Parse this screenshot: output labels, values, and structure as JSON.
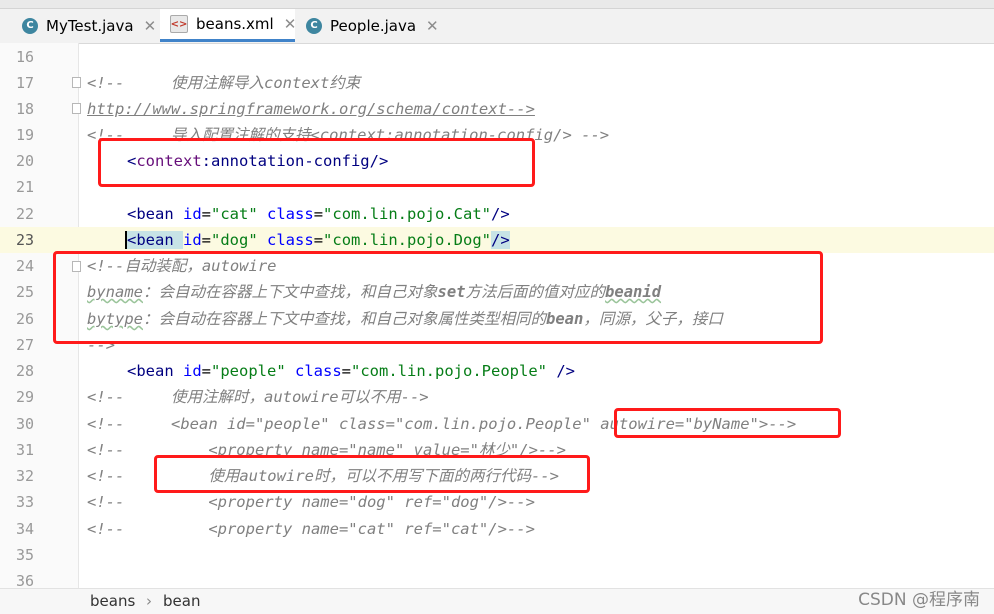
{
  "tabs": [
    {
      "label": "MyTest.java",
      "icon": "java-class-icon",
      "active": false
    },
    {
      "label": "beans.xml",
      "icon": "xml-file-icon",
      "active": true
    },
    {
      "label": "People.java",
      "icon": "java-class-icon",
      "active": false
    }
  ],
  "lines": [
    {
      "num": "16"
    },
    {
      "num": "17",
      "c1": "<!--     使用注解导入context约束"
    },
    {
      "num": "18",
      "c1": "http://www.springframework.org/schema/context-->"
    },
    {
      "num": "19",
      "c1": "<!--     导入配置注解的支持<context:annotation-config/> -->"
    },
    {
      "num": "20",
      "c1": "<",
      "c2": "context",
      "c3": ":annotation-config",
      "c4": "/>"
    },
    {
      "num": "21"
    },
    {
      "num": "22",
      "c1": "<bean ",
      "c2": "id",
      "c3": "=",
      "c4": "\"cat\"",
      "c5": " class",
      "c6": "=",
      "c7": "\"com.lin.pojo.Cat\"",
      "c8": "/>"
    },
    {
      "num": "23",
      "c1": "<bean ",
      "c2": "id",
      "c3": "=",
      "c4": "\"dog\"",
      "c5": " class",
      "c6": "=",
      "c7": "\"com.lin.pojo.Dog\"",
      "c8": "/>"
    },
    {
      "num": "24",
      "c1": "<!--自动装配，autowire"
    },
    {
      "num": "25",
      "c1": "byname",
      "c2": "：会自动在容器上下文中查找，和自己对象",
      "c3": "set",
      "c4": "方法后面的值对应的",
      "c5": "beanid"
    },
    {
      "num": "26",
      "c1": "bytype",
      "c2": "：会自动在容器上下文中查找，和自己对象属性类型相同的",
      "c3": "bean",
      "c4": "，同源，父子，接口"
    },
    {
      "num": "27",
      "c1": "-->"
    },
    {
      "num": "28",
      "c1": "<bean ",
      "c2": "id",
      "c3": "=",
      "c4": "\"people\"",
      "c5": " class",
      "c6": "=",
      "c7": "\"com.lin.pojo.People\"",
      "c8": " />"
    },
    {
      "num": "29",
      "c1": "<!--     使用注解时，autowire可以不用-->"
    },
    {
      "num": "30",
      "c1": "<!--     <bean id=\"people\" class=\"com.lin.pojo.People\" autowire=\"byName\">-->"
    },
    {
      "num": "31",
      "c1": "<!--         <property name=\"name\" value=\"林少\"/>-->"
    },
    {
      "num": "32",
      "c1": "<!--         使用autowire时，可以不用写下面的两行代码-->"
    },
    {
      "num": "33",
      "c1": "<!--         <property name=\"dog\" ref=\"dog\"/>-->"
    },
    {
      "num": "34",
      "c1": "<!--         <property name=\"cat\" ref=\"cat\"/>-->"
    },
    {
      "num": "35"
    },
    {
      "num": "36"
    }
  ],
  "breadcrumb": {
    "item1": "beans",
    "separator": "›",
    "item2": "bean"
  },
  "watermark": "CSDN @程序南",
  "colors": {
    "annotation_box": "#ff1a1a",
    "active_tab_underline": "#4083c9"
  }
}
